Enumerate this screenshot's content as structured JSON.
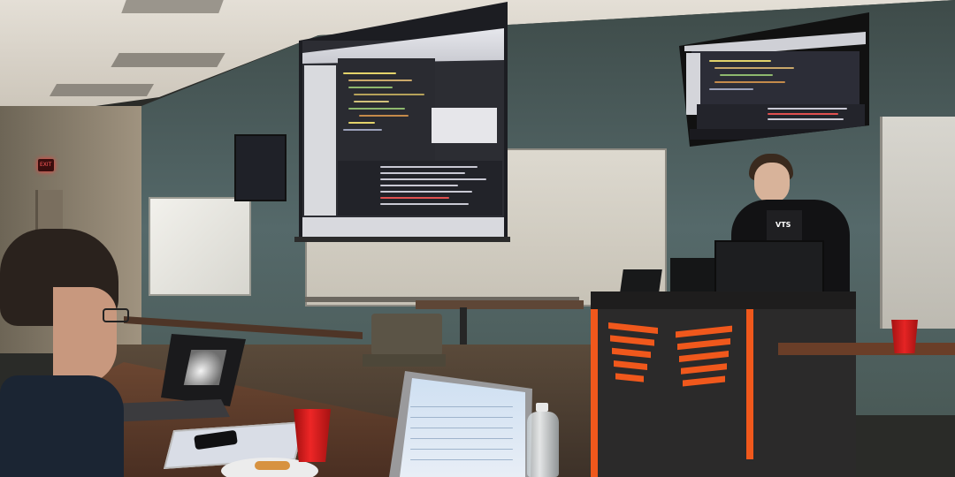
{
  "scene": {
    "description_free": true,
    "exit_sign_text": "EXIT",
    "presenter_shirt_text": "VTS"
  },
  "colors": {
    "ceiling": "#d9d3c8",
    "wall_back": "#4d5f5c",
    "wall_left": "#8b7f6c",
    "projection": "#e9e6df",
    "ide_dark": "#2f2f35",
    "ide_light": "#dcdde2",
    "podium": "#2b2a2a",
    "podium_accent": "#f0581c",
    "desk": "#5a3a28",
    "cup_red": "#d81c1c",
    "floor": "#4a3b2e"
  },
  "icons": {
    "exit": "exit-sign-icon",
    "water_bottle": "water-bottle-icon",
    "cup": "red-cup-icon"
  }
}
